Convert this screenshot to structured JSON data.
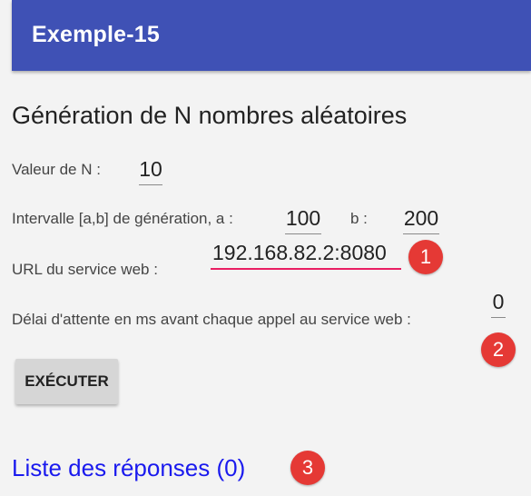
{
  "app": {
    "title": "Exemple-15"
  },
  "main": {
    "heading": "Génération de N nombres aléatoires",
    "n": {
      "label": "Valeur de N :",
      "value": "10"
    },
    "interval": {
      "label_a": "Intervalle [a,b] de génération, a :",
      "a": "100",
      "label_b": "b :",
      "b": "200"
    },
    "url": {
      "label": "URL du service web :",
      "value": "192.168.82.2:8080"
    },
    "delay": {
      "label": "Délai d'attente en ms avant chaque appel au service web :",
      "value": "0"
    },
    "execute_button": "EXÉCUTER",
    "responses_link": "Liste des réponses (0)"
  },
  "annotations": {
    "badge1": "1",
    "badge2": "2",
    "badge3": "3",
    "color": "#e53935"
  },
  "colors": {
    "appbar": "#3f51b5",
    "focus_underline": "#e91e63",
    "link": "#1a1aee"
  }
}
